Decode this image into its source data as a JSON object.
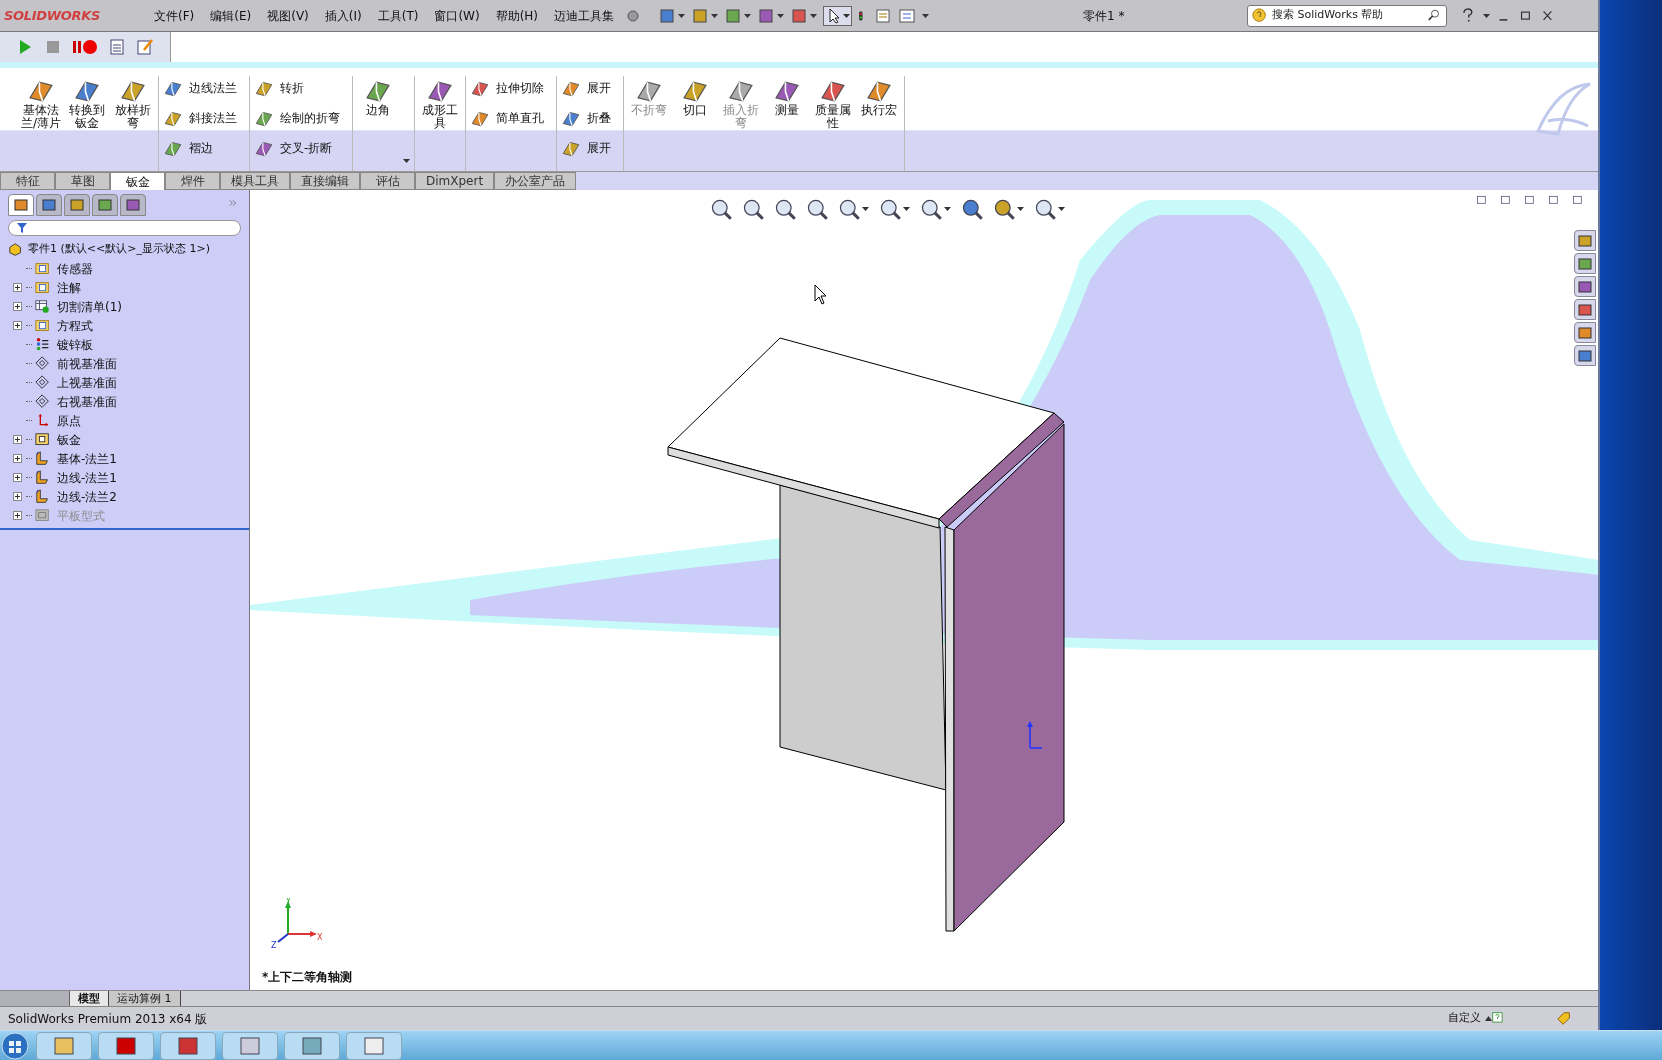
{
  "app": {
    "logo": "SOLIDWORKS",
    "title": "零件1 *"
  },
  "menu": [
    "文件(F)",
    "编辑(E)",
    "视图(V)",
    "插入(I)",
    "工具(T)",
    "窗口(W)",
    "帮助(H)",
    "迈迪工具集"
  ],
  "search": {
    "placeholder": "搜索 SolidWorks 帮助"
  },
  "ribbon": [
    {
      "kind": "large",
      "items": [
        {
          "label": "基体法兰/薄片",
          "disabled": false
        },
        {
          "label": "转换到钣金",
          "disabled": false
        },
        {
          "label": "放样折弯",
          "disabled": false
        }
      ]
    },
    {
      "kind": "stack",
      "items": [
        {
          "label": "边线法兰",
          "disabled": false
        },
        {
          "label": "斜接法兰",
          "disabled": false
        },
        {
          "label": "褶边",
          "disabled": false
        }
      ]
    },
    {
      "kind": "stack",
      "items": [
        {
          "label": "转折",
          "disabled": false
        },
        {
          "label": "绘制的折弯",
          "disabled": false
        },
        {
          "label": "交叉-折断",
          "disabled": false
        }
      ]
    },
    {
      "kind": "large",
      "items": [
        {
          "label": "边角",
          "disabled": false
        }
      ]
    },
    {
      "kind": "large",
      "items": [
        {
          "label": "成形工具",
          "disabled": false
        }
      ]
    },
    {
      "kind": "stack",
      "items": [
        {
          "label": "拉伸切除",
          "disabled": false
        },
        {
          "label": "简单直孔",
          "disabled": false
        }
      ]
    },
    {
      "kind": "stack",
      "items": [
        {
          "label": "展开",
          "disabled": false
        },
        {
          "label": "折叠",
          "disabled": false
        },
        {
          "label": "展开",
          "disabled": false
        }
      ]
    },
    {
      "kind": "large",
      "items": [
        {
          "label": "不折弯",
          "disabled": true
        },
        {
          "label": "切口",
          "disabled": false
        },
        {
          "label": "插入折弯",
          "disabled": true
        },
        {
          "label": "测量",
          "disabled": false
        },
        {
          "label": "质量属性",
          "disabled": false
        },
        {
          "label": "执行宏",
          "disabled": false
        }
      ]
    }
  ],
  "tabs": [
    {
      "label": "特征",
      "selected": false
    },
    {
      "label": "草图",
      "selected": false
    },
    {
      "label": "钣金",
      "selected": true
    },
    {
      "label": "焊件",
      "selected": false
    },
    {
      "label": "模具工具",
      "selected": false
    },
    {
      "label": "直接编辑",
      "selected": false
    },
    {
      "label": "评估",
      "selected": false
    },
    {
      "label": "DimXpert",
      "selected": false
    },
    {
      "label": "办公室产品",
      "selected": false
    }
  ],
  "panel_tabs": [
    {
      "selected": true
    },
    {
      "selected": false
    },
    {
      "selected": false
    },
    {
      "selected": false
    },
    {
      "selected": false
    }
  ],
  "tree": {
    "root": "零件1  (默认<<默认>_显示状态 1>)",
    "items": [
      {
        "label": "传感器",
        "kind": "sensor",
        "expandable": false,
        "disabled": false
      },
      {
        "label": "注解",
        "kind": "annotation",
        "expandable": true,
        "disabled": false
      },
      {
        "label": "切割清单(1)",
        "kind": "cutlist",
        "expandable": true,
        "disabled": false
      },
      {
        "label": "方程式",
        "kind": "equation",
        "expandable": true,
        "disabled": false
      },
      {
        "label": "镀锌板",
        "kind": "material",
        "expandable": false,
        "disabled": false
      },
      {
        "label": "前视基准面",
        "kind": "plane",
        "expandable": false,
        "disabled": false
      },
      {
        "label": "上视基准面",
        "kind": "plane",
        "expandable": false,
        "disabled": false
      },
      {
        "label": "右视基准面",
        "kind": "plane",
        "expandable": false,
        "disabled": false
      },
      {
        "label": "原点",
        "kind": "origin",
        "expandable": false,
        "disabled": false
      },
      {
        "label": "钣金",
        "kind": "sheetmetal",
        "expandable": true,
        "disabled": false
      },
      {
        "label": "基体-法兰1",
        "kind": "baseflange",
        "expandable": true,
        "disabled": false
      },
      {
        "label": "边线-法兰1",
        "kind": "edgeflange",
        "expandable": true,
        "disabled": false
      },
      {
        "label": "边线-法兰2",
        "kind": "edgeflange",
        "expandable": true,
        "disabled": false
      },
      {
        "label": "平板型式",
        "kind": "flat",
        "expandable": true,
        "disabled": true
      }
    ]
  },
  "triad": [
    "Y",
    "X",
    "Z"
  ],
  "view_label": "*上下二等角轴测",
  "bottom_tabs": [
    {
      "label": "模型",
      "selected": true
    },
    {
      "label": "运动算例 1",
      "selected": false
    }
  ],
  "status": {
    "product": "SolidWorks Premium 2013 x64 版",
    "units": "自定义"
  }
}
